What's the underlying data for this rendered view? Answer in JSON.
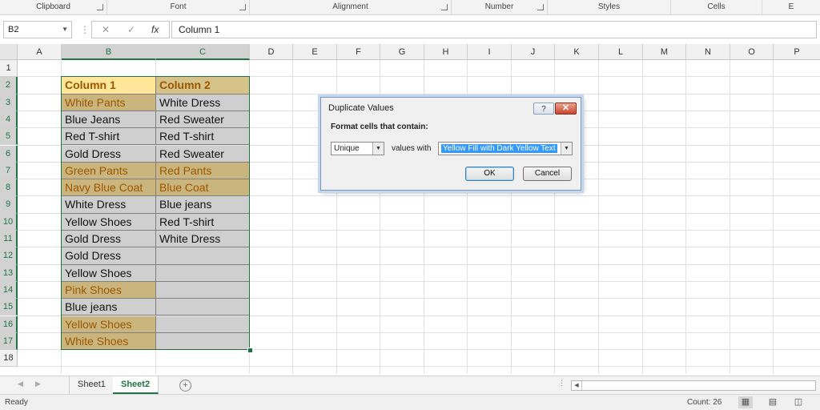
{
  "ribbon": {
    "groups": [
      "Clipboard",
      "Font",
      "Alignment",
      "Number",
      "Styles",
      "Cells",
      "E"
    ]
  },
  "formula_bar": {
    "name_box": "B2",
    "cancel_icon": "✕",
    "enter_icon": "✓",
    "fx_label": "fx",
    "content": "Column 1"
  },
  "grid": {
    "columns": [
      "A",
      "B",
      "C",
      "D",
      "E",
      "F",
      "G",
      "H",
      "I",
      "J",
      "K",
      "L",
      "M",
      "N",
      "O",
      "P"
    ],
    "rows": [
      "1",
      "2",
      "3",
      "4",
      "5",
      "6",
      "7",
      "8",
      "9",
      "10",
      "11",
      "12",
      "13",
      "14",
      "15",
      "16",
      "17",
      "18"
    ],
    "data": [
      {
        "b": "Column 1",
        "c": "Column 2"
      },
      {
        "b": "White Pants",
        "c": "White Dress"
      },
      {
        "b": "Blue Jeans",
        "c": "Red Sweater"
      },
      {
        "b": "Red T-shirt",
        "c": "Red T-shirt"
      },
      {
        "b": "Gold Dress",
        "c": "Red Sweater"
      },
      {
        "b": "Green Pants",
        "c": "Red Pants"
      },
      {
        "b": "Navy Blue Coat",
        "c": "Blue Coat"
      },
      {
        "b": "White Dress",
        "c": "Blue jeans"
      },
      {
        "b": "Yellow Shoes",
        "c": "Red T-shirt"
      },
      {
        "b": "Gold Dress",
        "c": "White Dress"
      },
      {
        "b": "Gold Dress",
        "c": ""
      },
      {
        "b": "Yellow Shoes",
        "c": ""
      },
      {
        "b": "Pink Shoes",
        "c": ""
      },
      {
        "b": "Blue jeans",
        "c": ""
      },
      {
        "b": "Yellow Shoes",
        "c": ""
      },
      {
        "b": "White Shoes",
        "c": ""
      }
    ]
  },
  "dialog": {
    "title": "Duplicate Values",
    "help_label": "?",
    "close_label": "✕",
    "prompt": "Format cells that contain:",
    "type_value": "Unique",
    "values_with_label": "values with",
    "format_value": "Yellow Fill with Dark Yellow Text",
    "ok_label": "OK",
    "cancel_label": "Cancel"
  },
  "tabs": {
    "sheets": [
      "Sheet1",
      "Sheet2"
    ],
    "active": "Sheet2",
    "add_label": "+"
  },
  "status": {
    "ready": "Ready",
    "count": "Count: 26"
  },
  "colors": {
    "accent": "#217346",
    "unique_fill": "#c9b57d",
    "unique_text": "#9c5700",
    "header_fill": "#ffe699"
  }
}
